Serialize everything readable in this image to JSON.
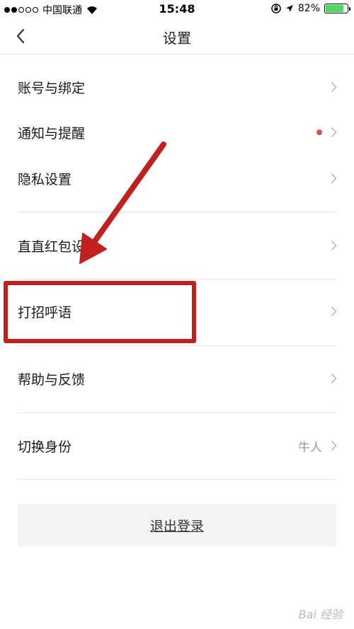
{
  "status_bar": {
    "carrier": "中国联通",
    "time": "15:48",
    "battery_percent": "82%",
    "battery_level": 0.82
  },
  "nav": {
    "title": "设置",
    "back_icon": "chevron-left-icon"
  },
  "rows": [
    {
      "label": "账号与绑定"
    },
    {
      "label": "通知与提醒",
      "badge": "red-dot"
    },
    {
      "label": "隐私设置"
    },
    {
      "label": "直直红包设置"
    },
    {
      "label": "打招呼语"
    },
    {
      "label": "帮助与反馈"
    },
    {
      "label": "切换身份",
      "value": "牛人"
    }
  ],
  "logout_label": "退出登录",
  "annotation": {
    "color": "#c0201e"
  },
  "watermark": "Bai 经验"
}
